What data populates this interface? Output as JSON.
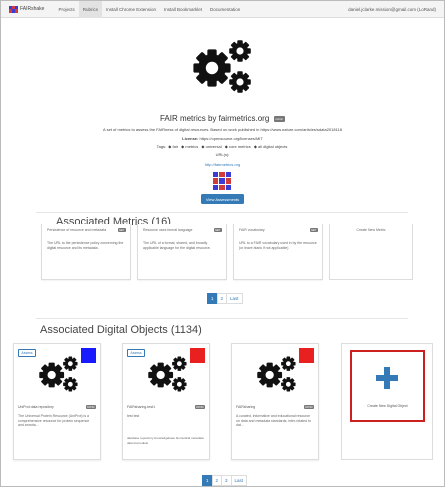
{
  "navbar": {
    "brand": "FAIRshake",
    "items": [
      "Projects",
      "Rubrics",
      "Install Chrome Extension",
      "Install Bookmarklet",
      "Documentation"
    ],
    "active_index": 1,
    "user": "daniel.jclarke.mission@gmail.com (LoRand)"
  },
  "rubric": {
    "title": "FAIR metrics by fairmetrics.org",
    "title_badge": "rubric",
    "description": "A set of metrics to assess the FAIRness of digital resources. Based on work published in https://www.nature.com/articles/sdata2018118",
    "license_label": "License:",
    "license_value": "https://opensource.org/licenses/MIT",
    "tags_label": "Tags:",
    "tags": [
      "fair",
      "metrics",
      "universal",
      "core metrics",
      "all digital objects"
    ],
    "urls_label": "URL(s):",
    "url": "http://fairmetrics.org",
    "assess_button": "View Assessments"
  },
  "metrics": {
    "heading": "Associated Metrics (16)",
    "cards": [
      {
        "title": "Persistence of resource and metadata",
        "badge": "MET",
        "description": "The URL to the persistence policy concerning the digital resource and its metadata."
      },
      {
        "title": "Resource uses formal language",
        "badge": "MET",
        "description": "The URL of a formal, shared, and broadly applicable language for the digital resource."
      },
      {
        "title": "FAIR vocabulary",
        "badge": "MET",
        "description": "URL to a FAIR vocabulary used in by the resource (or leave blank if not applicable)"
      }
    ],
    "new_label": "Create New Metric",
    "pagination": [
      "1",
      "2",
      "Last"
    ]
  },
  "objects": {
    "heading": "Associated Digital Objects (1134)",
    "assess_label": "Assess",
    "cards": [
      {
        "title": "UniProt data repository",
        "badge": "FROM",
        "description": "The Universal Protein Resource (UniProt) is a comprehensive resource for protein sequence and annota...",
        "tags": "",
        "insignia": "blue"
      },
      {
        "title": "FAIRsharing-test1",
        "badge": "FROM",
        "description": "test test",
        "tags": "database   repository   knowledgebase   biomedical   metadata   data   biomedical",
        "insignia": "red"
      },
      {
        "title": "FAIRsharing",
        "badge": "FROM",
        "description": "A curated, informative and educational resource on data and metadata standards, inter-related to dat...",
        "tags": "",
        "insignia": "red"
      }
    ],
    "new_label": "Create New Digital Object",
    "pagination": [
      "1",
      "2",
      "3",
      "Last"
    ]
  },
  "colors": {
    "primary": "#337ab7",
    "insignia_blue": "#1a1aff",
    "insignia_red": "#e82020",
    "highlight_red": "#cc1f1f",
    "badge_gray": "#777777"
  },
  "icons": {
    "gears": "gears-icon",
    "tag": "tag-icon",
    "plus": "plus-icon"
  }
}
